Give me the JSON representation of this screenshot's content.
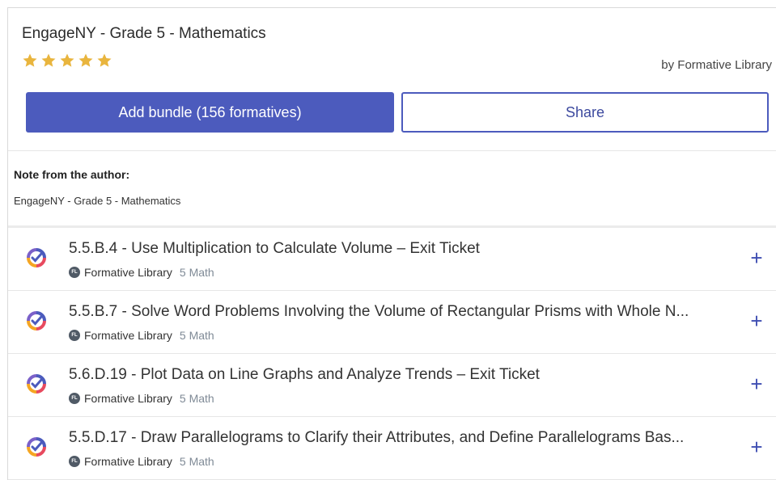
{
  "header": {
    "title": "EngageNY - Grade 5 - Mathematics",
    "rating": 5,
    "author": "by Formative Library",
    "colors": {
      "star": "#e9b53e",
      "accent": "#4c5bbd"
    }
  },
  "actions": {
    "add_label": "Add bundle (156 formatives)",
    "share_label": "Share"
  },
  "note": {
    "label": "Note from the author:",
    "text": "EngageNY - Grade 5 - Mathematics"
  },
  "items": [
    {
      "title": "5.5.B.4 - Use Multiplication to Calculate Volume – Exit Ticket",
      "library": "Formative Library",
      "subject": "5 Math",
      "icon": "formative-logo-icon",
      "action_icon": "plus-icon"
    },
    {
      "title": "5.5.B.7 - Solve Word Problems Involving the Volume of Rectangular Prisms with Whole N...",
      "library": "Formative Library",
      "subject": "5 Math",
      "icon": "formative-logo-icon",
      "action_icon": "plus-icon"
    },
    {
      "title": "5.6.D.19 - Plot Data on Line Graphs and Analyze Trends – Exit Ticket",
      "library": "Formative Library",
      "subject": "5 Math",
      "icon": "formative-logo-icon",
      "action_icon": "plus-icon"
    },
    {
      "title": "5.5.D.17 - Draw Parallelograms to Clarify their Attributes, and Define Parallelograms Bas...",
      "library": "Formative Library",
      "subject": "5 Math",
      "icon": "formative-logo-icon",
      "action_icon": "plus-icon"
    }
  ]
}
